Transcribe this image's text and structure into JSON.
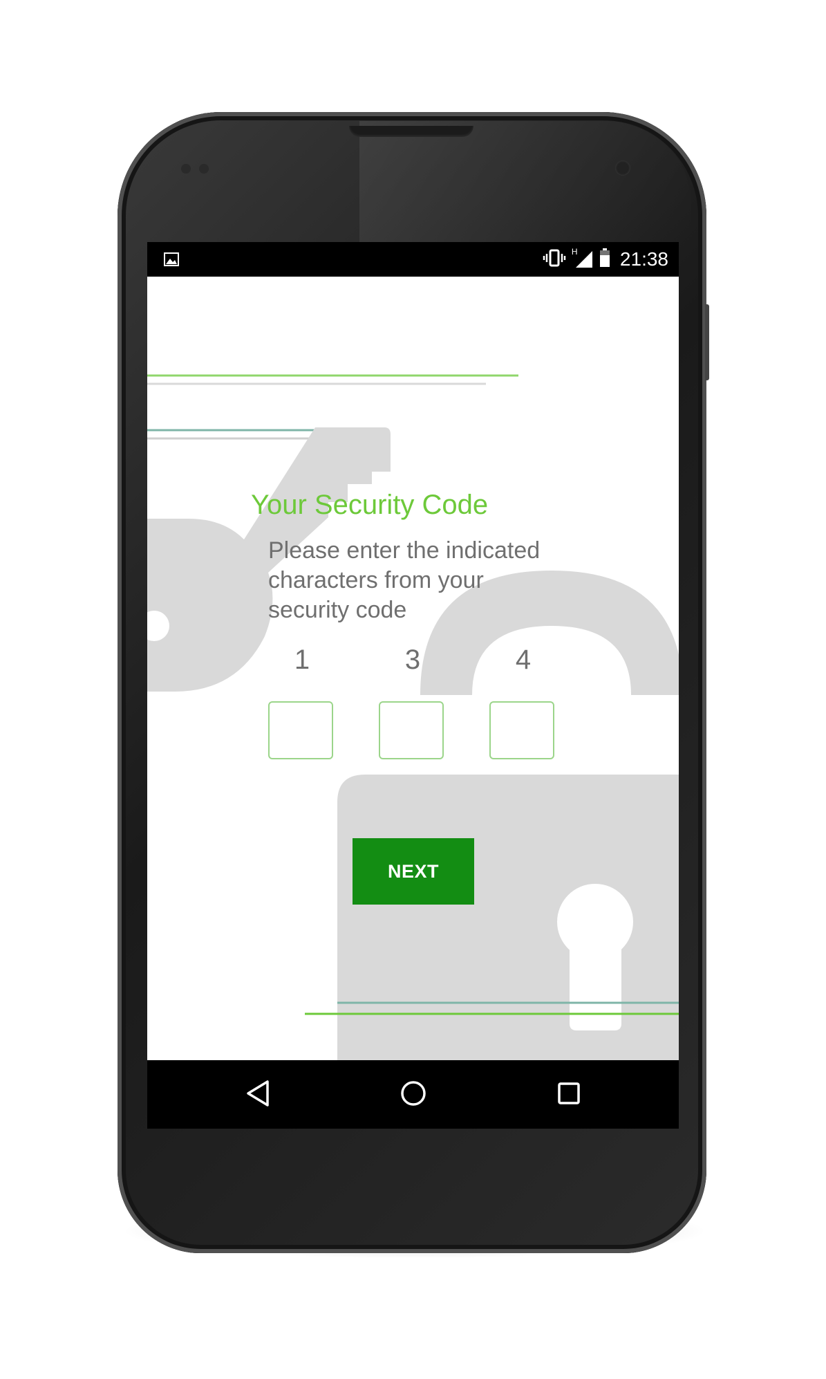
{
  "status_bar": {
    "time": "21:38",
    "left_icon": "image-notification-icon",
    "right_icons": [
      "vibrate-icon",
      "signal-icon",
      "battery-icon"
    ],
    "network_label": "H"
  },
  "screen": {
    "title": "Your Security Code",
    "instructions": "Please enter the indicated\ncharacters from your\nsecurity code",
    "digits": [
      {
        "label": "1",
        "value": ""
      },
      {
        "label": "3",
        "value": ""
      },
      {
        "label": "4",
        "value": ""
      }
    ],
    "next_label": "NEXT"
  },
  "nav_bar": {
    "icons": [
      "back-icon",
      "home-icon",
      "recents-icon"
    ]
  },
  "colors": {
    "accent_green": "#6dc93a",
    "button_green": "#138d13",
    "text_gray": "#6f6f6f",
    "background_shape_gray": "#d9d9d9",
    "line_teal": "#7fb5a8"
  }
}
